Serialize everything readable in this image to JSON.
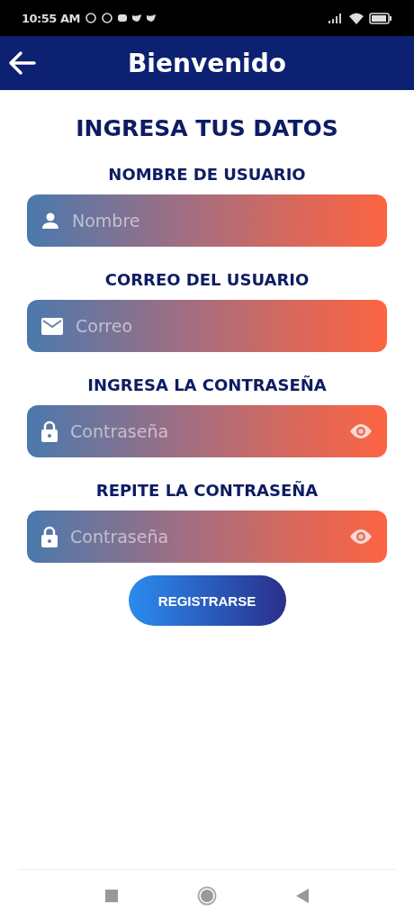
{
  "status_bar": {
    "time": "10:55 AM"
  },
  "header": {
    "title": "Bienvenido"
  },
  "form": {
    "heading": "INGRESA TUS DATOS",
    "fields": [
      {
        "label": "NOMBRE DE USUARIO",
        "kind": "person",
        "placeholder": "Nombre",
        "reveal_toggle": false
      },
      {
        "label": "CORREO DEL USUARIO",
        "kind": "mail",
        "placeholder": "Correo",
        "reveal_toggle": false
      },
      {
        "label": "INGRESA LA CONTRASEÑA",
        "kind": "lock",
        "placeholder": "Contraseña",
        "reveal_toggle": true
      },
      {
        "label": "REPITE LA CONTRASEÑA",
        "kind": "lock",
        "placeholder": "Contraseña",
        "reveal_toggle": true
      }
    ],
    "submit": "REGISTRARSE"
  }
}
